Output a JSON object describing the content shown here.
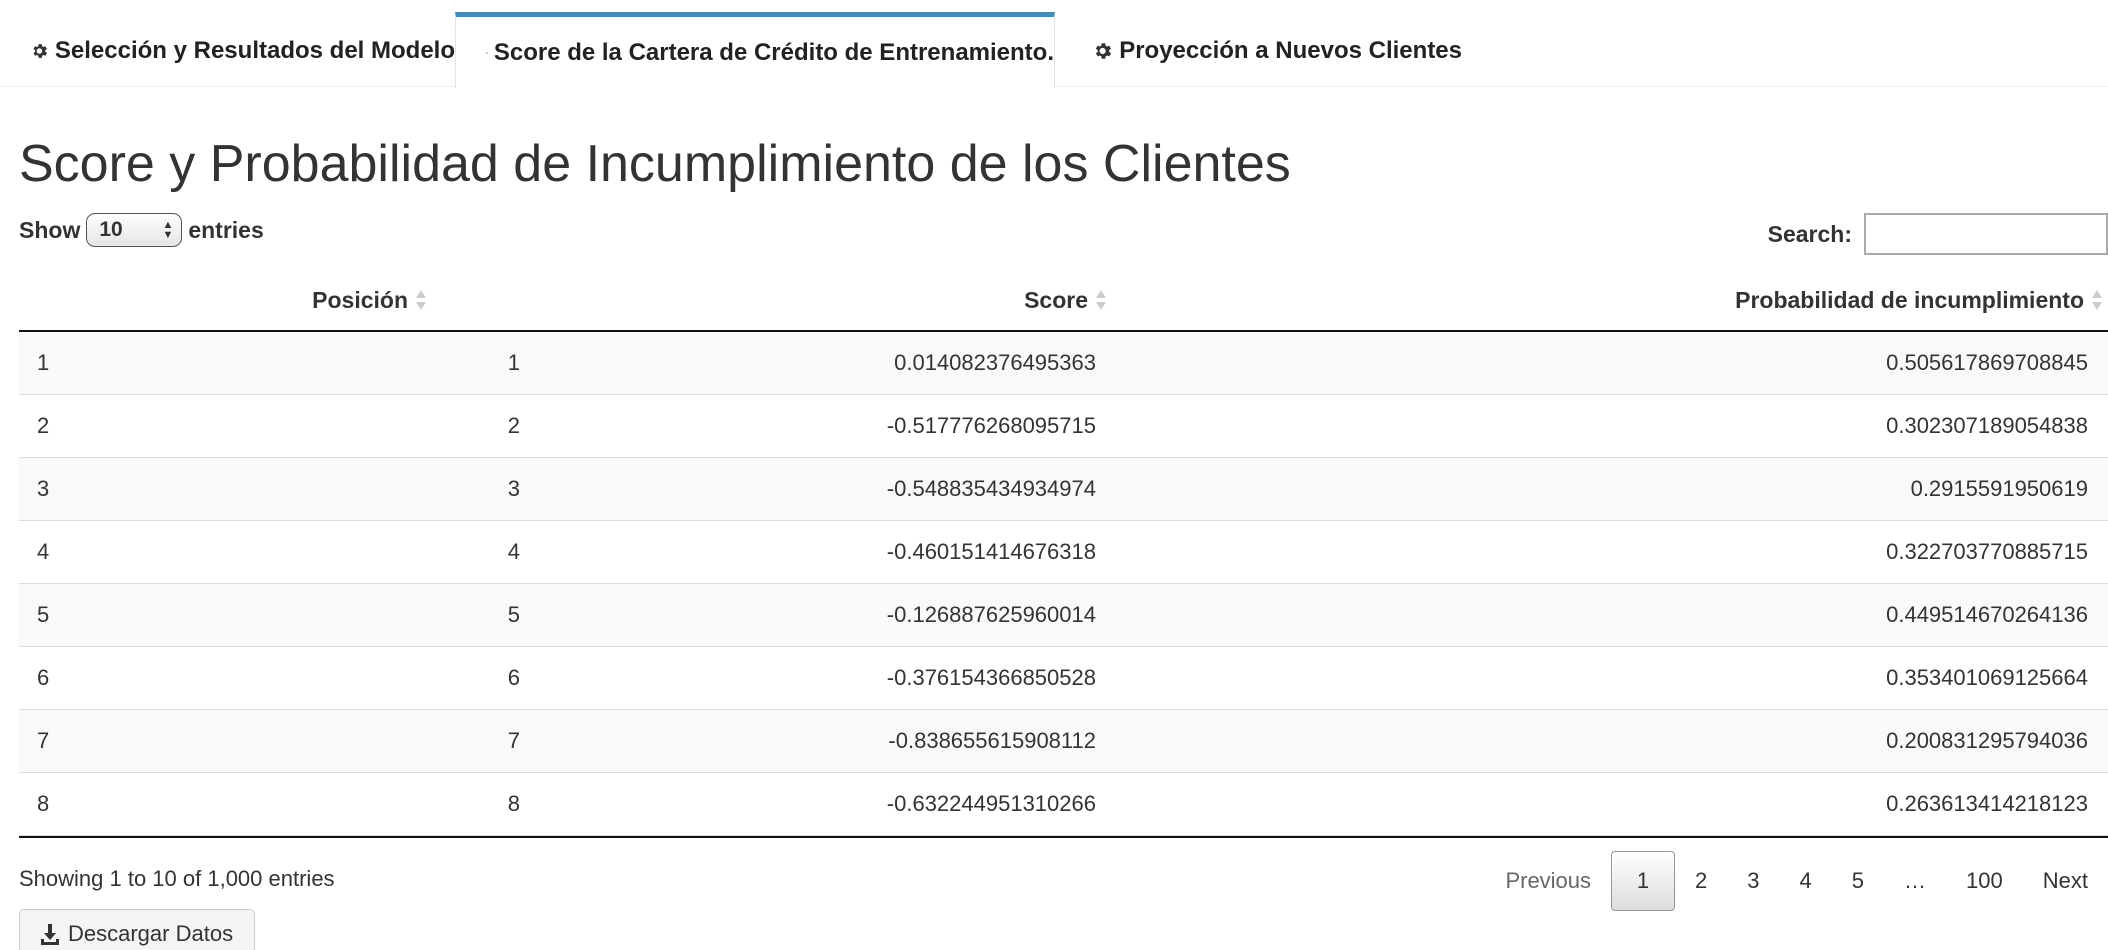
{
  "tabs": [
    {
      "label": "Selección y Resultados del Modelo",
      "icon": "gear-icon",
      "active": false
    },
    {
      "label": "Score de la Cartera de Crédito de Entrenamiento.",
      "icon": "gear-icon",
      "active": true
    },
    {
      "label": "Proyección a Nuevos Clientes",
      "icon": "gear-icon",
      "active": false
    }
  ],
  "page": {
    "title": "Score y Probabilidad de Incumplimiento de los Clientes"
  },
  "length": {
    "show_label": "Show",
    "selected": "10",
    "entries_label": "entries"
  },
  "search": {
    "label": "Search:",
    "value": ""
  },
  "table": {
    "columns": [
      "",
      "Posición",
      "Score",
      "Probabilidad de incumplimiento"
    ],
    "rows": [
      [
        "1",
        "1",
        "0.014082376495363",
        "0.505617869708845"
      ],
      [
        "2",
        "2",
        "-0.517776268095715",
        "0.302307189054838"
      ],
      [
        "3",
        "3",
        "-0.548835434934974",
        "0.2915591950619"
      ],
      [
        "4",
        "4",
        "-0.460151414676318",
        "0.322703770885715"
      ],
      [
        "5",
        "5",
        "-0.126887625960014",
        "0.449514670264136"
      ],
      [
        "6",
        "6",
        "-0.376154366850528",
        "0.353401069125664"
      ],
      [
        "7",
        "7",
        "-0.838655615908112",
        "0.200831295794036"
      ],
      [
        "8",
        "8",
        "-0.632244951310266",
        "0.263613414218123"
      ]
    ]
  },
  "info": "Showing 1 to 10 of 1,000 entries",
  "pagination": {
    "previous": "Previous",
    "pages": [
      "1",
      "2",
      "3",
      "4",
      "5",
      "…",
      "100"
    ],
    "current": "1",
    "next": "Next"
  },
  "download": {
    "label": "Descargar Datos",
    "icon": "download-icon"
  },
  "colors": {
    "accent": "#3c8dbc",
    "row_stripe": "#f9f9f9"
  }
}
